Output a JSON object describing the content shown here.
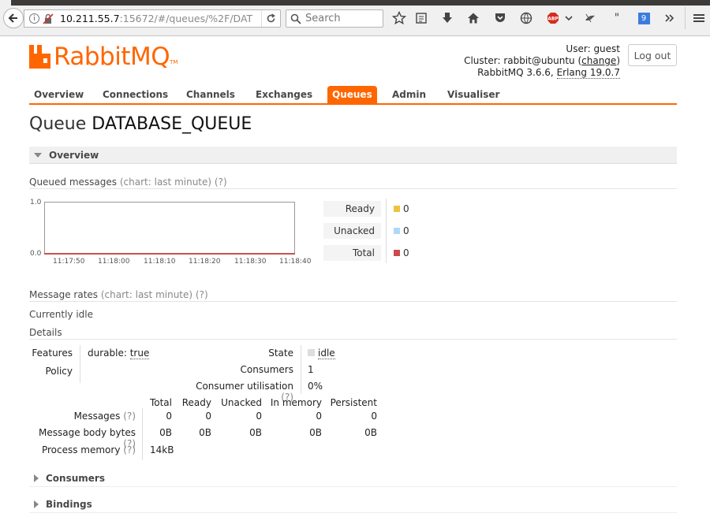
{
  "browser": {
    "url_host": "10.211.55.7",
    "url_rest": ":15672/#/queues/%2F/DAT",
    "search_placeholder": "Search",
    "tab_count": "9"
  },
  "brand": {
    "logo_text": "RabbitMQ",
    "tm": "TM",
    "accent": "#ff6600"
  },
  "header": {
    "user_label": "User:",
    "user": "guest",
    "cluster_label": "Cluster:",
    "cluster": "rabbit@ubuntu",
    "change_link": "change",
    "version_prefix": "RabbitMQ 3.6.6,",
    "erlang": "Erlang 19.0.7",
    "logout_label": "Log out"
  },
  "tabs": [
    {
      "label": "Overview"
    },
    {
      "label": "Connections"
    },
    {
      "label": "Channels"
    },
    {
      "label": "Exchanges"
    },
    {
      "label": "Queues",
      "selected": true
    },
    {
      "label": "Admin"
    },
    {
      "label": "Visualiser"
    }
  ],
  "page": {
    "title_prefix": "Queue",
    "queue_name": "DATABASE_QUEUE"
  },
  "overview": {
    "title": "Overview",
    "queued_label": "Queued messages",
    "queued_hint": "(chart: last minute) (?)",
    "chart": {
      "y_max_label": "1.0",
      "y_min_label": "0.0",
      "x_labels": [
        "11:17:50",
        "11:18:00",
        "11:18:10",
        "11:18:20",
        "11:18:30",
        "11:18:40"
      ]
    },
    "legend": [
      {
        "label": "Ready",
        "value": "0",
        "color": "#edc240"
      },
      {
        "label": "Unacked",
        "value": "0",
        "color": "#afd8f8"
      },
      {
        "label": "Total",
        "value": "0",
        "color": "#cb4b4b"
      }
    ],
    "rates_label": "Message rates",
    "rates_hint": "(chart: last minute) (?)",
    "idle_text": "Currently idle",
    "details_label": "Details",
    "features_label": "Features",
    "features_key": "durable:",
    "features_value": "true",
    "policy_label": "Policy",
    "state_label": "State",
    "state_value": "idle",
    "consumers_label": "Consumers",
    "consumers_value": "1",
    "utilisation_label": "Consumer utilisation",
    "utilisation_hint": "(?)",
    "utilisation_value": "0%",
    "stats_headers": [
      "Total",
      "Ready",
      "Unacked",
      "In memory",
      "Persistent"
    ],
    "stats_rows": [
      {
        "label": "Messages",
        "hint": "(?)",
        "values": [
          "0",
          "0",
          "0",
          "0",
          "0"
        ]
      },
      {
        "label": "Message body bytes",
        "hint": "(?)",
        "values": [
          "0B",
          "0B",
          "0B",
          "0B",
          "0B"
        ]
      },
      {
        "label": "Process memory",
        "hint": "(?)",
        "values": [
          "14kB"
        ]
      }
    ]
  },
  "sections": {
    "consumers": "Consumers",
    "bindings": "Bindings"
  }
}
